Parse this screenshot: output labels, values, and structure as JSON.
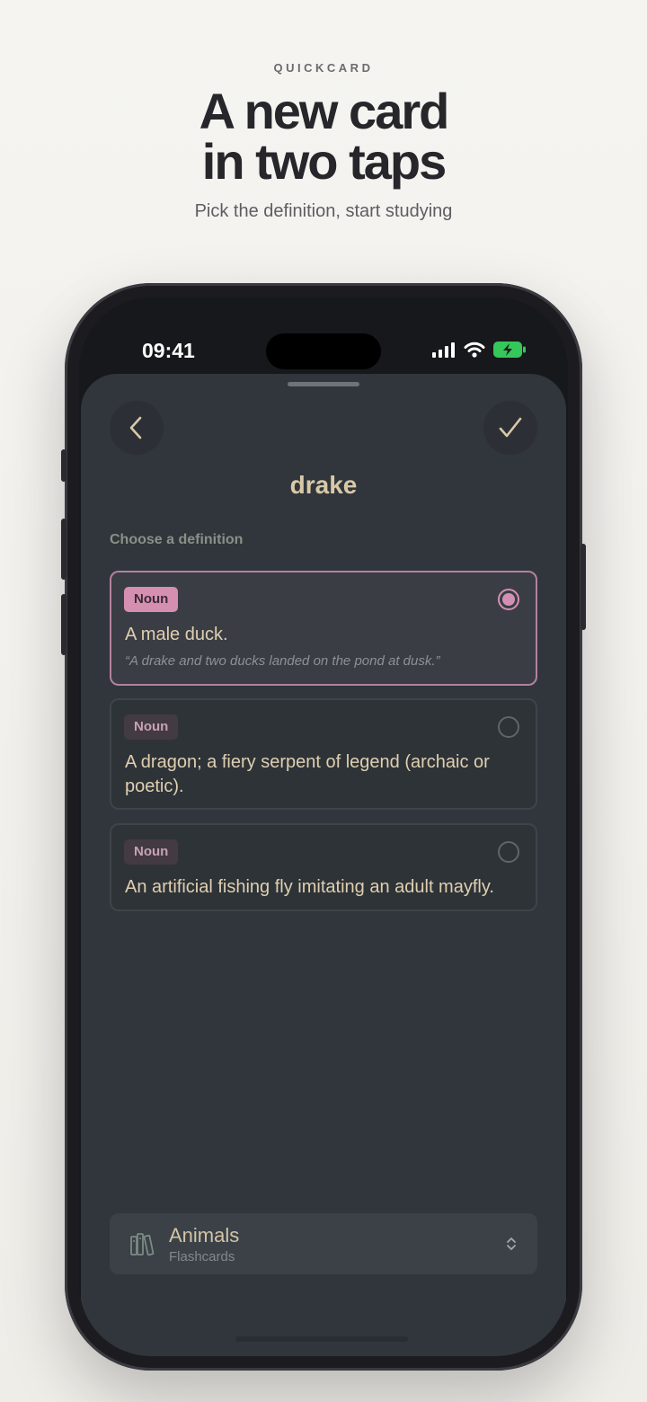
{
  "hero": {
    "eyebrow": "QUICKCARD",
    "headline_line1": "A new card",
    "headline_line2": "in two taps",
    "subhead": "Pick the definition, start studying"
  },
  "status_bar": {
    "time": "09:41",
    "icons": [
      "signal-icon",
      "wifi-icon",
      "battery-charging-icon"
    ],
    "battery_color": "#34c759"
  },
  "sheet": {
    "back_icon": "chevron-left-icon",
    "confirm_icon": "checkmark-icon",
    "word": "drake",
    "section_label": "Choose a definition",
    "definitions": [
      {
        "part_of_speech": "Noun",
        "text": "A male duck.",
        "example": "“A drake and two ducks landed on the pond at dusk.”",
        "selected": true
      },
      {
        "part_of_speech": "Noun",
        "text": "A dragon; a fiery serpent of legend (archaic or poetic).",
        "selected": false
      },
      {
        "part_of_speech": "Noun",
        "text": "An artificial fishing fly imitating an adult mayfly.",
        "selected": false
      }
    ],
    "deck": {
      "icon": "books-icon",
      "name": "Animals",
      "type": "Flashcards",
      "chevron_icon": "chevron-up-down-icon"
    }
  },
  "colors": {
    "accent": "#d490b4",
    "word": "#d9c8a7",
    "sheet_bg": "#31363c"
  }
}
